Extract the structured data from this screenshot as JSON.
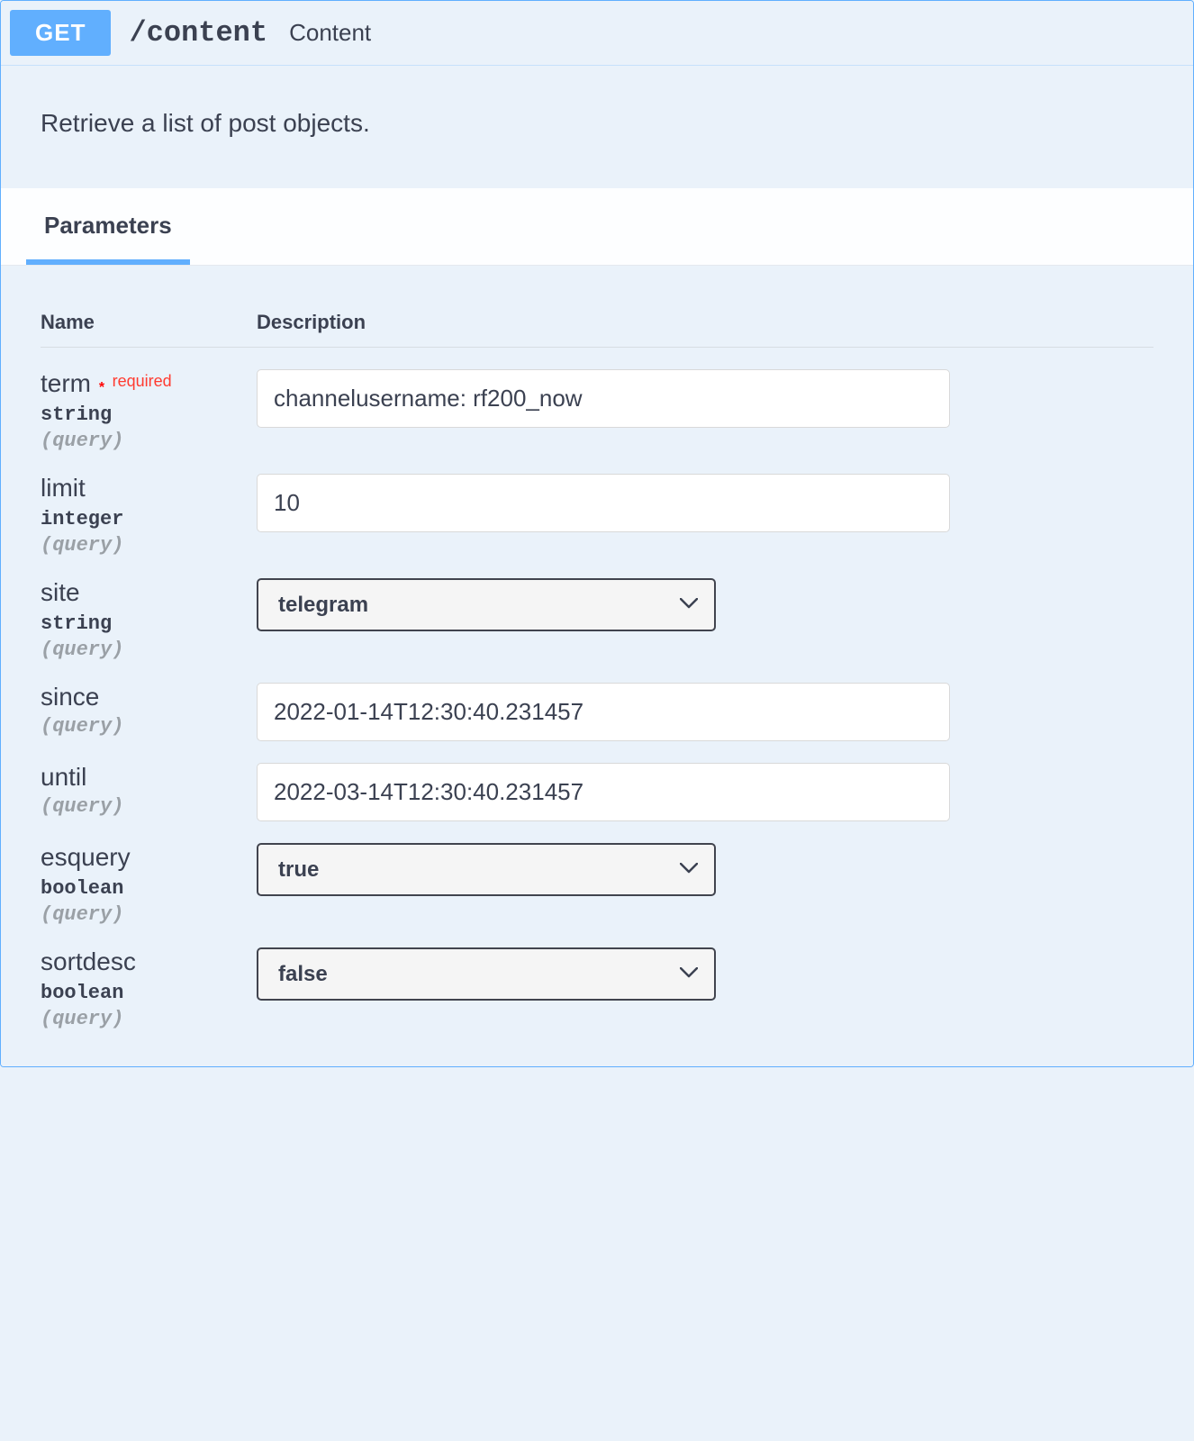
{
  "operation": {
    "method": "GET",
    "path": "/content",
    "summary": "Content",
    "description": "Retrieve a list of post objects."
  },
  "tabs": {
    "parameters": "Parameters"
  },
  "table": {
    "name_header": "Name",
    "desc_header": "Description"
  },
  "labels": {
    "required": "required",
    "in_query": "(query)"
  },
  "params": {
    "term": {
      "name": "term",
      "type": "string",
      "required": true,
      "value": "channelusername: rf200_now"
    },
    "limit": {
      "name": "limit",
      "type": "integer",
      "value": "10"
    },
    "site": {
      "name": "site",
      "type": "string",
      "value": "telegram"
    },
    "since": {
      "name": "since",
      "value": "2022-01-14T12:30:40.231457"
    },
    "until": {
      "name": "until",
      "value": "2022-03-14T12:30:40.231457"
    },
    "esquery": {
      "name": "esquery",
      "type": "boolean",
      "value": "true"
    },
    "sortdesc": {
      "name": "sortdesc",
      "type": "boolean",
      "value": "false"
    }
  }
}
